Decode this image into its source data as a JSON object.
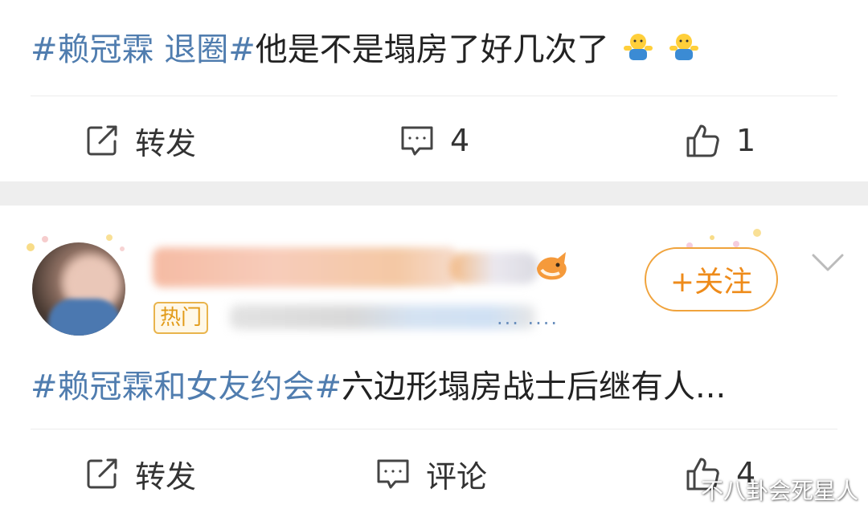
{
  "post1": {
    "text_parts": [
      {
        "type": "hashtag",
        "text": "#赖冠霖 退圈#"
      },
      {
        "type": "plain",
        "text": "他是不是塌房了好几次了"
      }
    ],
    "emoji_name": "shrug-emoji",
    "actions": {
      "repost_label": "转发",
      "comment_count": "4",
      "like_count": "1"
    }
  },
  "post2": {
    "hot_tag": "热门",
    "meta_ellipsis": "... ....",
    "follow_label": "+关注",
    "text_parts": [
      {
        "type": "hashtag",
        "text": "#赖冠霖和女友约会#"
      },
      {
        "type": "plain",
        "text": "六边形塌房战士后继有人..."
      }
    ],
    "actions": {
      "repost_label": "转发",
      "comment_label": "评论",
      "like_count": "4"
    }
  },
  "watermark": "不八卦会死星人",
  "colors": {
    "hashtag": "#507daf",
    "text": "#222222",
    "follow": "#ee8b1a",
    "divider": "#eeeeee"
  },
  "icons": {
    "repost": "repost-icon",
    "comment": "comment-icon",
    "like": "thumbs-up-icon",
    "chevron": "chevron-down-icon"
  }
}
